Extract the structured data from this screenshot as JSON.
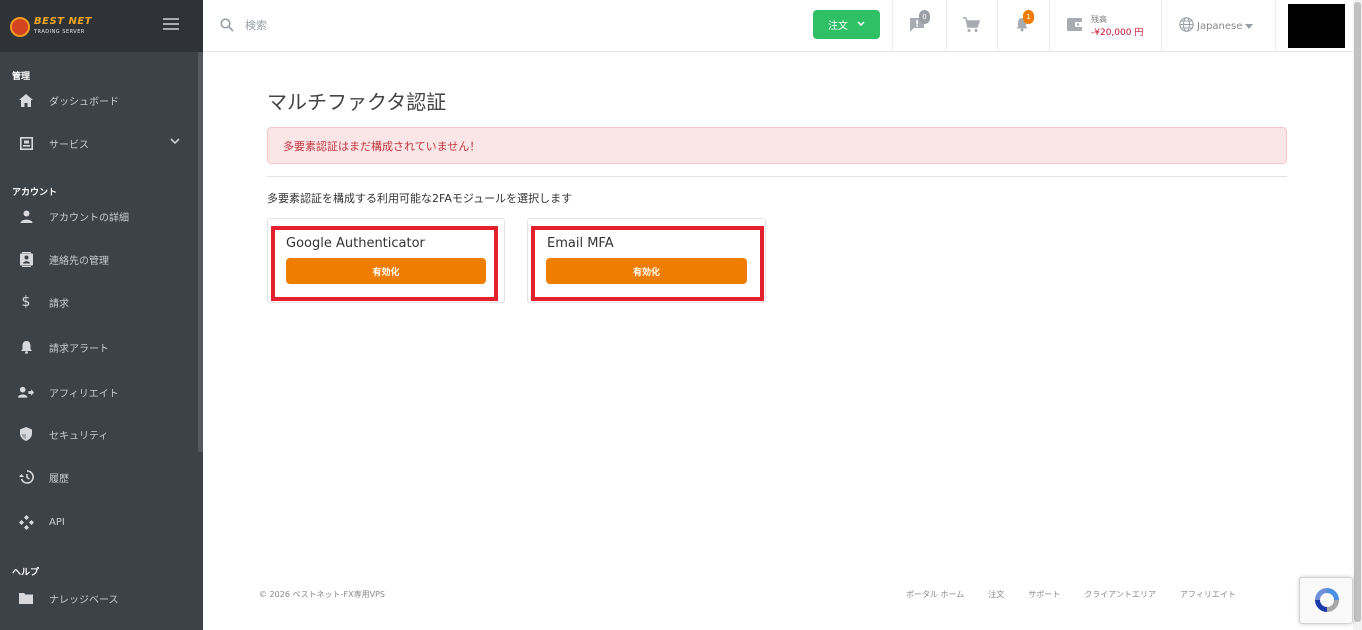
{
  "brand": {
    "title": "BEST NET",
    "subtitle": "TRADING SERVER"
  },
  "sidebar": {
    "sections": [
      {
        "label": "管理"
      },
      {
        "label": "アカウント"
      },
      {
        "label": "ヘルプ"
      }
    ],
    "items": [
      {
        "label": "ダッシュボード",
        "icon": "home-icon"
      },
      {
        "label": "サービス",
        "icon": "services-icon"
      },
      {
        "label": "アカウントの詳細",
        "icon": "user-icon"
      },
      {
        "label": "連絡先の管理",
        "icon": "contacts-icon"
      },
      {
        "label": "請求",
        "icon": "dollar-icon"
      },
      {
        "label": "請求アラート",
        "icon": "bell-icon"
      },
      {
        "label": "アフィリエイト",
        "icon": "affiliate-icon"
      },
      {
        "label": "セキュリティ",
        "icon": "shield-icon"
      },
      {
        "label": "履歴",
        "icon": "history-icon"
      },
      {
        "label": "API",
        "icon": "api-icon"
      },
      {
        "label": "ナレッジベース",
        "icon": "folder-icon"
      }
    ]
  },
  "header": {
    "search_placeholder": "検索",
    "order_label": "注文",
    "messages_count": "0",
    "notifications_count": "1",
    "balance_label": "残高",
    "balance_value": "-¥20,000 円",
    "language": "Japanese"
  },
  "main": {
    "title": "マルチファクタ認証",
    "alert": "多要素認証はまだ構成されていません！",
    "instruction": "多要素認証を構成する利用可能な2FAモジュールを選択します",
    "modules": [
      {
        "name": "Google Authenticator",
        "button": "有効化"
      },
      {
        "name": "Email MFA",
        "button": "有効化"
      }
    ]
  },
  "footer": {
    "copyright": "© 2026 ベストネット-FX専用VPS",
    "links": [
      "ポータル ホーム",
      "注文",
      "サポート",
      "クライアントエリア",
      "アフィリエイト"
    ]
  },
  "colors": {
    "sidebar_bg": "#3d4148",
    "order_button": "#2fbf65",
    "enable_button": "#ef7d00",
    "highlight": "#e3202b",
    "alert_text": "#c1343f"
  }
}
